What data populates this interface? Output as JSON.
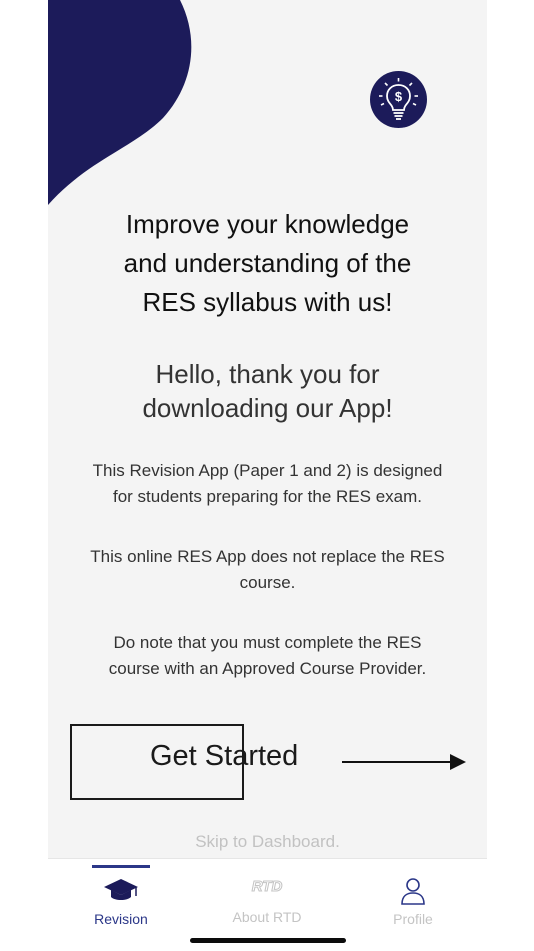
{
  "colors": {
    "brand": "#1c1b5a",
    "accent": "#2b3788",
    "muted": "#c2c2c2",
    "background": "#f4f4f4"
  },
  "hero": {
    "icon": "dollar-lightbulb-icon",
    "headline": [
      "Improve your knowledge",
      "and understanding of the",
      "RES syllabus with us!"
    ]
  },
  "greeting": [
    "Hello, thank you for",
    "downloading our App!"
  ],
  "paragraphs": [
    [
      "This Revision App (Paper 1 and 2) is designed",
      "for students preparing for the RES exam."
    ],
    [
      "This online RES App does not replace the RES",
      "course."
    ],
    [
      "Do note that you must complete the RES",
      "course with an Approved Course Provider."
    ]
  ],
  "cta": {
    "label": "Get Started",
    "icon": "arrow-right-icon"
  },
  "skip_link": "Skip to Dashboard.",
  "tabs": [
    {
      "label": "Revision",
      "icon": "graduation-cap-icon",
      "active": true
    },
    {
      "label": "About RTD",
      "icon": "rtd-logo-icon",
      "active": false
    },
    {
      "label": "Profile",
      "icon": "user-icon",
      "active": false
    }
  ]
}
